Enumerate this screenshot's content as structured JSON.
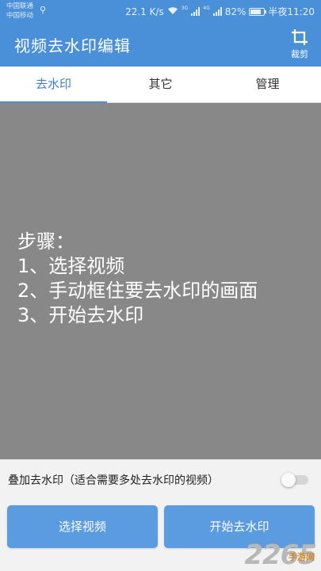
{
  "status_bar": {
    "carrier1": "中国联通",
    "carrier2": "中国移动",
    "speed": "22.1 K/s",
    "sig1_tag": "3G",
    "sig2_tag": "4G",
    "battery": "82%",
    "battery_level": 0.82,
    "time": "半夜11:20"
  },
  "appbar": {
    "title": "视频去水印编辑",
    "crop_label": "裁剪"
  },
  "tabs": [
    {
      "label": "去水印",
      "active": true
    },
    {
      "label": "其它",
      "active": false
    },
    {
      "label": "管理",
      "active": false
    }
  ],
  "video": {
    "steps": [
      "步骤：",
      "1、选择视频",
      "2、手动框住要去水印的画面",
      "3、开始去水印"
    ]
  },
  "option": {
    "label": "叠加去水印（适合需要多处去水印的视频）",
    "enabled": false
  },
  "buttons": {
    "select_video": "选择视频",
    "start": "开始去水印"
  },
  "watermark": {
    "number": "2265",
    "suffix": "手游网"
  },
  "colors": {
    "primary": "#4a90d9",
    "button": "#5b9be0",
    "video_bg": "#888888"
  }
}
